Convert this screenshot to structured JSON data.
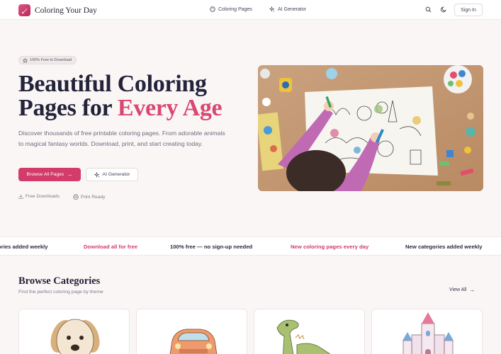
{
  "brand": {
    "name": "Coloring Your Day",
    "logo_icon": "brush-icon",
    "accent": "#d23b6a"
  },
  "nav": {
    "links": [
      {
        "label": "Coloring Pages",
        "icon": "palette-icon"
      },
      {
        "label": "AI Generator",
        "icon": "sparkle-icon"
      }
    ],
    "search_icon": "search-icon",
    "theme_icon": "moon-icon",
    "signin_label": "Sign In"
  },
  "hero": {
    "badge": "100% Free to Download",
    "title_line1": "Beautiful Coloring",
    "title_line2_prefix": "Pages for ",
    "title_accent": "Every Age",
    "description": "Discover thousands of free printable coloring pages. From adorable animals to magical fantasy worlds. Download, print, and start creating today.",
    "primary_button": "Browse All Pages",
    "secondary_button": "AI Generator",
    "features": [
      {
        "label": "Free Downloads",
        "icon": "download-icon"
      },
      {
        "label": "Print Ready",
        "icon": "printer-icon"
      }
    ]
  },
  "ticker": [
    {
      "text": "ories added weekly",
      "style": "dark"
    },
    {
      "text": "Download all for free",
      "style": "pink"
    },
    {
      "text": "100% free — no sign-up needed",
      "style": "dark"
    },
    {
      "text": "New coloring pages every day",
      "style": "pink"
    },
    {
      "text": "New categories added weekly",
      "style": "dark"
    }
  ],
  "categories": {
    "title": "Browse Categories",
    "subtitle": "Find the perfect coloring page by theme",
    "view_all": "View All",
    "cards": [
      {
        "subject": "dog"
      },
      {
        "subject": "car"
      },
      {
        "subject": "dinosaur"
      },
      {
        "subject": "castle"
      }
    ]
  }
}
